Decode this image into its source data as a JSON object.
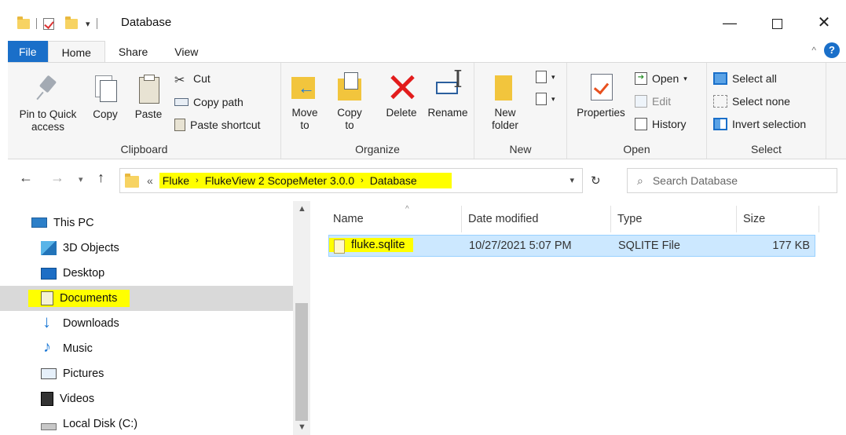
{
  "window": {
    "title": "Database",
    "min_glyph": "—",
    "close_glyph": "✕",
    "qat_dropdown": "▾"
  },
  "tabs": [
    {
      "label": "File"
    },
    {
      "label": "Home"
    },
    {
      "label": "Share"
    },
    {
      "label": "View"
    }
  ],
  "ribbon": {
    "clipboard": {
      "label": "Clipboard",
      "pin": "Pin to Quick access",
      "copy": "Copy",
      "paste": "Paste",
      "cut": "Cut",
      "copy_path": "Copy path",
      "paste_shortcut": "Paste shortcut"
    },
    "organize": {
      "label": "Organize",
      "move_to": "Move to",
      "copy_to": "Copy to",
      "delete": "Delete",
      "rename": "Rename"
    },
    "new": {
      "label": "New",
      "new_folder": "New folder"
    },
    "open": {
      "label": "Open",
      "properties": "Properties",
      "open": "Open",
      "edit": "Edit",
      "history": "History"
    },
    "select": {
      "label": "Select",
      "select_all": "Select all",
      "select_none": "Select none",
      "invert": "Invert selection"
    }
  },
  "address": {
    "overflow": "«",
    "crumbs": [
      "Fluke",
      "FlukeView 2 ScopeMeter 3.0.0",
      "Database"
    ],
    "search_placeholder": "Search Database"
  },
  "nav_pane": {
    "items": [
      {
        "label": "This PC",
        "icon": "computer-icon"
      },
      {
        "label": "3D Objects",
        "icon": "3d-objects-icon"
      },
      {
        "label": "Desktop",
        "icon": "desktop-icon"
      },
      {
        "label": "Documents",
        "icon": "documents-icon",
        "selected": true
      },
      {
        "label": "Downloads",
        "icon": "downloads-icon"
      },
      {
        "label": "Music",
        "icon": "music-icon"
      },
      {
        "label": "Pictures",
        "icon": "pictures-icon"
      },
      {
        "label": "Videos",
        "icon": "videos-icon"
      },
      {
        "label": "Local Disk (C:)",
        "icon": "drive-icon"
      }
    ]
  },
  "file_list": {
    "columns": [
      "Name",
      "Date modified",
      "Type",
      "Size"
    ],
    "rows": [
      {
        "name": "fluke.sqlite",
        "date": "10/27/2021 5:07 PM",
        "type": "SQLITE File",
        "size": "177 KB"
      }
    ]
  },
  "colors": {
    "accent": "#1a6fc9",
    "highlight": "#ffff00",
    "selection": "#cce8ff"
  }
}
